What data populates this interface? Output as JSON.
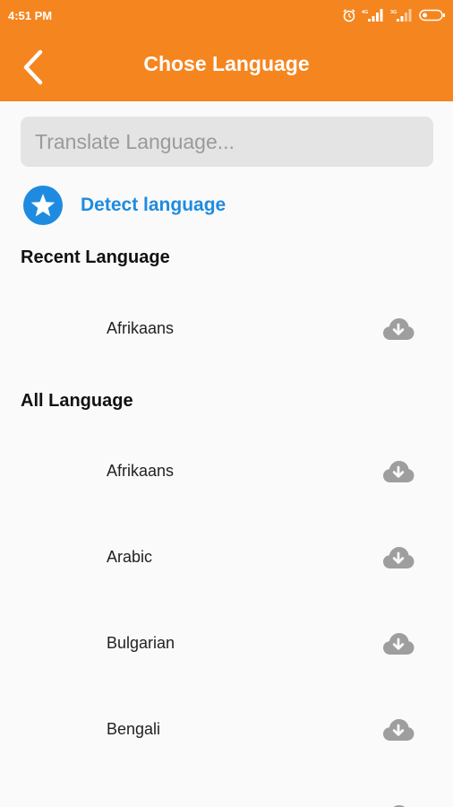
{
  "status_bar": {
    "time": "4:51 PM"
  },
  "header": {
    "title": "Chose Language",
    "background_color": "#f5851f"
  },
  "search": {
    "placeholder": "Translate Language...",
    "value": ""
  },
  "detect": {
    "label": "Detect language",
    "accent_color": "#1e8be0"
  },
  "recent_section": {
    "title": "Recent Language",
    "items": [
      {
        "name": "Afrikaans"
      }
    ]
  },
  "all_section": {
    "title": "All Language",
    "items": [
      {
        "name": "Afrikaans"
      },
      {
        "name": "Arabic"
      },
      {
        "name": "Bulgarian"
      },
      {
        "name": "Bengali"
      }
    ]
  },
  "icons": {
    "back": "back-arrow-icon",
    "detect": "star-icon",
    "download": "cloud-download-icon"
  }
}
